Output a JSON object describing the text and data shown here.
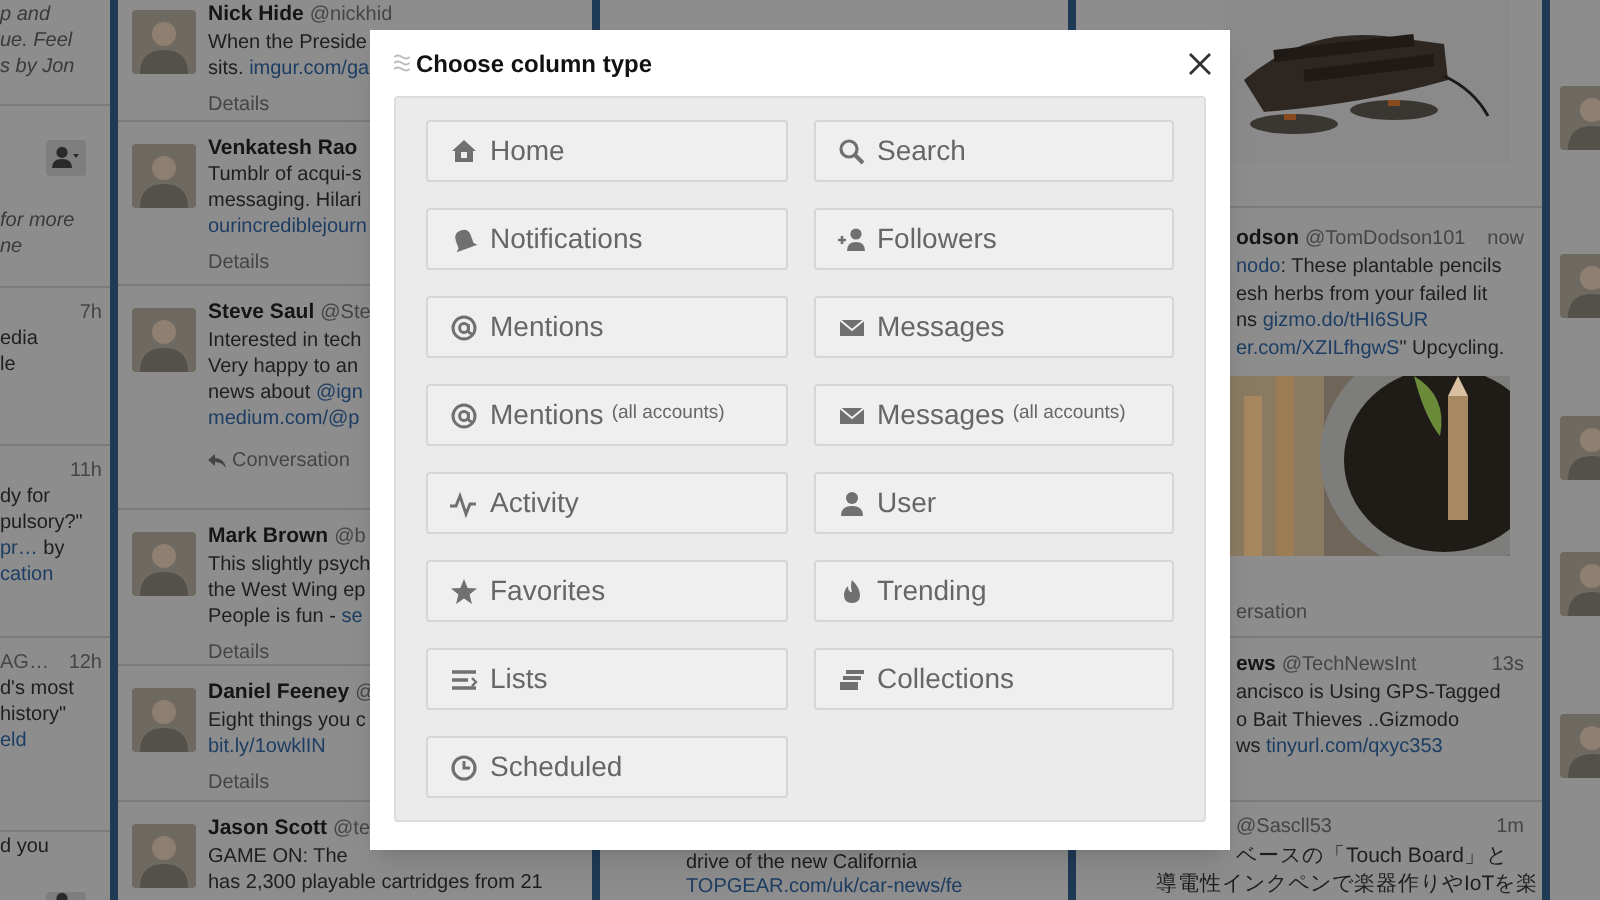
{
  "background": {
    "left_column": {
      "sections": [
        {
          "items": [
            {
              "kind": "note",
              "text": "p and",
              "link": false
            },
            {
              "kind": "note",
              "text": "ue. Feel",
              "link": false
            },
            {
              "kind": "note",
              "text": "s by Jon",
              "link": false
            }
          ]
        },
        {
          "items": [
            {
              "kind": "follow"
            },
            {
              "kind": "note",
              "text": "for more",
              "link": false
            },
            {
              "kind": "note",
              "text": "ne",
              "link": false
            }
          ]
        },
        {
          "items": [
            {
              "kind": "time",
              "text": "7h"
            },
            {
              "kind": "text",
              "text": "edia",
              "link": false
            },
            {
              "kind": "text",
              "text": "le",
              "link": false
            }
          ]
        },
        {
          "items": [
            {
              "kind": "time",
              "text": "11h"
            },
            {
              "kind": "text",
              "text": "dy for",
              "link": false
            },
            {
              "kind": "text",
              "text": "pulsory?\"",
              "link": false
            },
            {
              "kind": "text",
              "segments": [
                {
                  "text": "pr…",
                  "link": true
                },
                {
                  "text": " by",
                  "link": false
                }
              ]
            },
            {
              "kind": "text",
              "text": "cation",
              "link": true
            }
          ]
        },
        {
          "items": [
            {
              "kind": "meta",
              "text": "AG…",
              "time": "12h"
            },
            {
              "kind": "text",
              "text": "d's most",
              "link": false
            },
            {
              "kind": "text",
              "text": "history\"",
              "link": false
            },
            {
              "kind": "text",
              "text": "eld",
              "link": true
            }
          ]
        },
        {
          "items": [
            {
              "kind": "text",
              "text": "d you",
              "link": false
            },
            {
              "kind": "follow"
            }
          ]
        }
      ]
    },
    "tweet_column": {
      "tweets": [
        {
          "name": "Nick Hide",
          "handle": "@nickhid",
          "lines": [
            {
              "text": "When the Preside",
              "link": false
            },
            {
              "segments": [
                {
                  "text": "sits. ",
                  "link": false
                },
                {
                  "text": "imgur.com/ga",
                  "link": true
                }
              ]
            }
          ],
          "footer": {
            "kind": "details",
            "text": "Details"
          }
        },
        {
          "name": "Venkatesh Rao",
          "lines": [
            {
              "text": "Tumblr of acqui-s",
              "link": false
            },
            {
              "text": "messaging. Hilari",
              "link": false
            },
            {
              "text": "ourincrediblejourn",
              "link": true
            }
          ],
          "footer": {
            "kind": "details",
            "text": "Details"
          }
        },
        {
          "name": "Steve Saul",
          "handle": "@Ste",
          "lines": [
            {
              "text": "Interested in tech",
              "link": false
            },
            {
              "text": "Very happy to an",
              "link": false
            },
            {
              "segments": [
                {
                  "text": "news about ",
                  "link": false
                },
                {
                  "text": "@ign",
                  "link": true
                }
              ]
            },
            {
              "text": "medium.com/@p",
              "link": true
            }
          ],
          "footer": {
            "kind": "conversation",
            "text": "Conversation"
          }
        },
        {
          "name": "Mark Brown",
          "handle": "@b",
          "lines": [
            {
              "text": "This slightly psych",
              "link": false
            },
            {
              "text": "the West Wing ep",
              "link": false
            },
            {
              "segments": [
                {
                  "text": "People is fun - ",
                  "link": false
                },
                {
                  "text": "se",
                  "link": true
                }
              ]
            }
          ],
          "footer": {
            "kind": "details",
            "text": "Details"
          }
        },
        {
          "name": "Daniel Feeney",
          "handle": "@",
          "lines": [
            {
              "text": "Eight things you c",
              "link": false
            },
            {
              "text": "bit.ly/1owklIN",
              "link": true
            }
          ],
          "footer": {
            "kind": "details",
            "text": "Details"
          }
        },
        {
          "name": "Jason Scott",
          "handle": "@te",
          "lines": [
            {
              "text": "GAME ON: The",
              "link": false
            },
            {
              "text": "has 2,300 playable cartridges from 21",
              "link": false
            }
          ]
        }
      ]
    },
    "center_column": {
      "lines": [
        {
          "text": "drive of the new California",
          "link": false
        },
        {
          "text": "TOPGEAR.com/uk/car-news/fe",
          "link": true
        }
      ]
    },
    "right_column": {
      "items": [
        {
          "kind": "picture"
        },
        {
          "kind": "tweet",
          "name": "odson",
          "handle": "@TomDodson101",
          "time": "now",
          "lines": [
            {
              "segments": [
                {
                  "text": "nodo",
                  "link": true
                },
                {
                  "text": ": These plantable pencils",
                  "link": false
                }
              ]
            },
            {
              "text": "esh herbs from your failed lit",
              "link": false
            },
            {
              "segments": [
                {
                  "text": "ns ",
                  "link": false
                },
                {
                  "text": "gizmo.do/tHI6SUR",
                  "link": true
                }
              ]
            },
            {
              "segments": [
                {
                  "text": "er.com/XZILfhgwS",
                  "link": true
                },
                {
                  "text": "\" Upcycling.",
                  "link": false
                }
              ]
            }
          ]
        },
        {
          "kind": "picture"
        },
        {
          "kind": "footer",
          "text": "ersation"
        },
        {
          "kind": "rule"
        },
        {
          "kind": "tweet",
          "name": "ews",
          "handle": "@TechNewsInt",
          "time": "13s",
          "lines": [
            {
              "text": "ancisco is Using GPS-Tagged",
              "link": false
            },
            {
              "text": "o Bait Thieves ..Gizmodo",
              "link": false
            },
            {
              "segments": [
                {
                  "text": "ws ",
                  "link": false
                },
                {
                  "text": "tinyurl.com/qxyc353",
                  "link": true
                }
              ]
            }
          ]
        },
        {
          "kind": "rule"
        },
        {
          "kind": "tweet",
          "handle": "@Sascll53",
          "time": "1m",
          "lines": [
            {
              "text": "ベースの「Touch Board」と",
              "link": false
            },
            {
              "text": "導電性インクペンで楽器作りやIoTを楽",
              "link": false
            }
          ]
        }
      ]
    }
  },
  "dialog": {
    "title": "Choose column type",
    "options": [
      {
        "label": "Home"
      },
      {
        "label": "Search"
      },
      {
        "label": "Notifications"
      },
      {
        "label": "Followers"
      },
      {
        "label": "Mentions"
      },
      {
        "label": "Messages"
      },
      {
        "label": "Mentions",
        "note": "(all accounts)"
      },
      {
        "label": "Messages",
        "note": "(all accounts)"
      },
      {
        "label": "Activity"
      },
      {
        "label": "User"
      },
      {
        "label": "Favorites"
      },
      {
        "label": "Trending"
      },
      {
        "label": "Lists"
      },
      {
        "label": "Collections"
      },
      {
        "label": "Scheduled"
      }
    ]
  }
}
